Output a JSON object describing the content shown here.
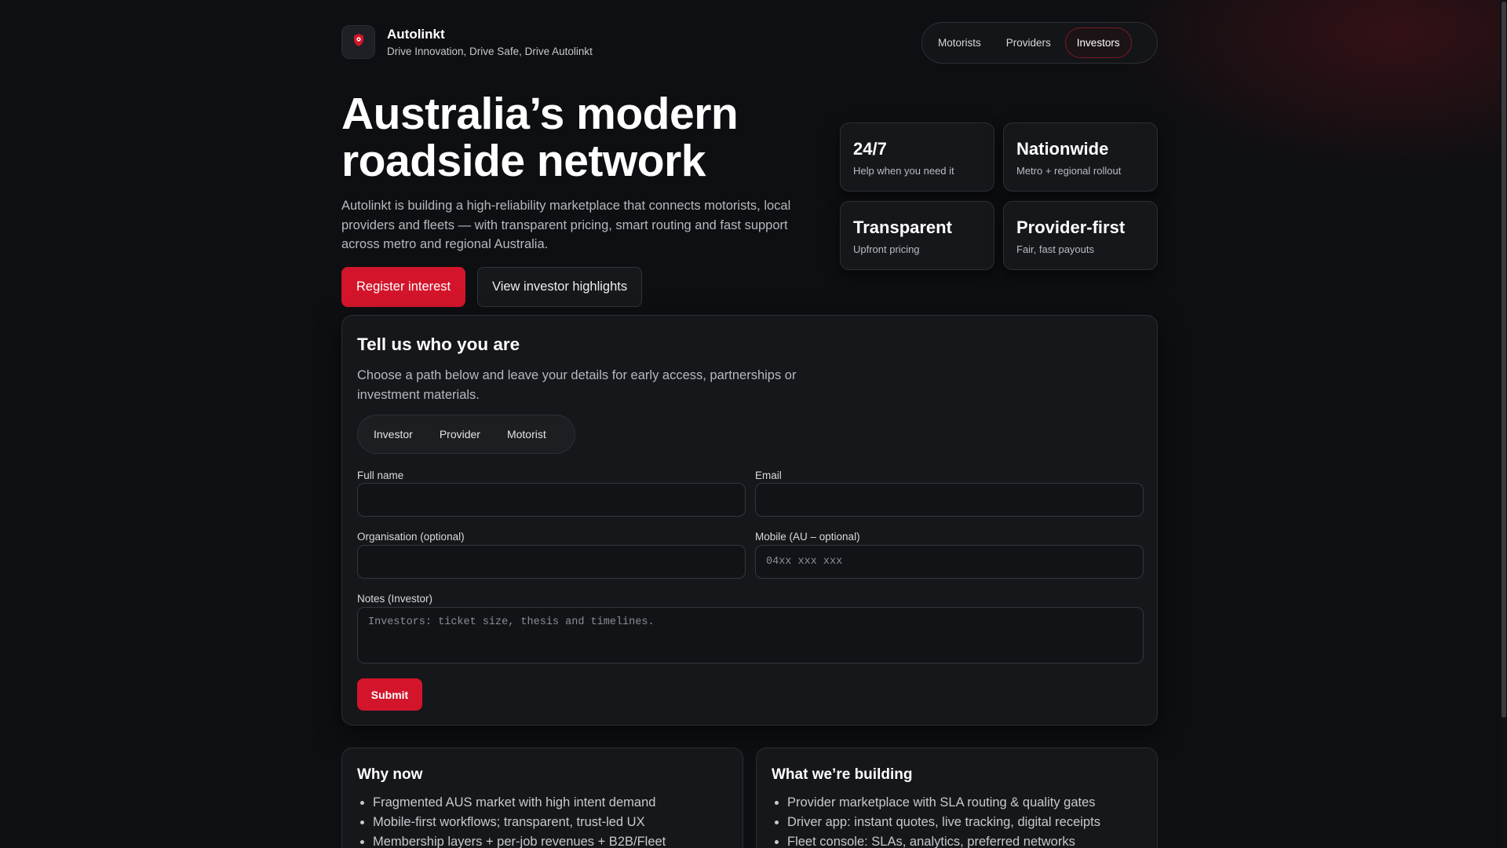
{
  "brand": {
    "name": "Autolinkt",
    "tagline": "Drive Innovation, Drive Safe, Drive Autolinkt",
    "logo_icon": "shield-pin-icon",
    "accent_color": "#d3152b"
  },
  "nav": {
    "items": [
      {
        "label": "Motorists",
        "active": false
      },
      {
        "label": "Providers",
        "active": false
      },
      {
        "label": "Investors",
        "active": true
      }
    ]
  },
  "hero": {
    "title_line1": "Australia’s modern",
    "title_line2": "roadside network",
    "description": "Autolinkt is building a high-reliability marketplace that connects motorists, local providers and fleets — with transparent pricing, smart routing and fast support across metro and regional Australia.",
    "primary_cta": "Register interest",
    "secondary_cta": "View investor highlights"
  },
  "stats": [
    {
      "title": "24/7",
      "subtitle": "Help when you need it"
    },
    {
      "title": "Nationwide",
      "subtitle": "Metro + regional rollout"
    },
    {
      "title": "Transparent",
      "subtitle": "Upfront pricing"
    },
    {
      "title": "Provider-first",
      "subtitle": "Fair, fast payouts"
    }
  ],
  "form": {
    "title": "Tell us who you are",
    "description": "Choose a path below and leave your details for early access, partnerships or investment materials.",
    "paths": [
      "Investor",
      "Provider",
      "Motorist"
    ],
    "full_name_label": "Full name",
    "full_name_value": "",
    "email_label": "Email",
    "email_value": "",
    "organisation_label": "Organisation (optional)",
    "organisation_value": "",
    "mobile_label": "Mobile (AU – optional)",
    "mobile_placeholder": "04xx xxx xxx",
    "notes_label": "Notes (Investor)",
    "notes_placeholder": "Investors: ticket size, thesis and timelines.",
    "submit_label": "Submit"
  },
  "why_now": {
    "title": "Why now",
    "items": [
      "Fragmented AUS market with high intent demand",
      "Mobile-first workflows; transparent, trust-led UX",
      "Membership layers + per-job revenues + B2B/Fleet"
    ]
  },
  "building": {
    "title": "What we’re building",
    "items": [
      "Provider marketplace with SLA routing & quality gates",
      "Driver app: instant quotes, live tracking, digital receipts",
      "Fleet console: SLAs, analytics, preferred networks"
    ]
  }
}
